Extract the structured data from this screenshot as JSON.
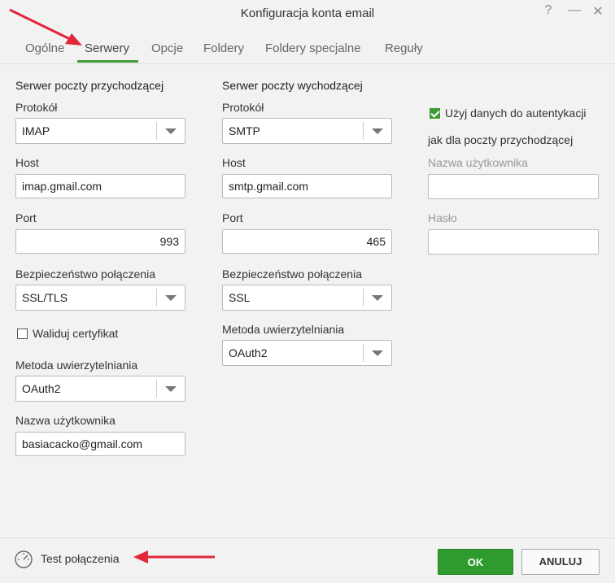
{
  "window": {
    "title": "Konfiguracja konta email",
    "help": "?",
    "minimize": "—",
    "close": "✕"
  },
  "tabs": [
    {
      "label": "Ogólne"
    },
    {
      "label": "Serwery"
    },
    {
      "label": "Opcje"
    },
    {
      "label": "Foldery"
    },
    {
      "label": "Foldery specjalne"
    },
    {
      "label": "Reguły"
    }
  ],
  "active_tab": "Serwery",
  "incoming": {
    "section_title": "Serwer poczty przychodzącej",
    "protocol_label": "Protokół",
    "protocol_value": "IMAP",
    "host_label": "Host",
    "host_value": "imap.gmail.com",
    "port_label": "Port",
    "port_value": "993",
    "security_label": "Bezpieczeństwo połączenia",
    "security_value": "SSL/TLS",
    "validate_cert_label": "Waliduj certyfikat",
    "validate_cert_checked": false,
    "auth_method_label": "Metoda uwierzytelniania",
    "auth_method_value": "OAuth2",
    "username_label": "Nazwa użytkownika",
    "username_value": "basiacacko@gmail.com"
  },
  "outgoing": {
    "section_title": "Serwer poczty wychodzącej",
    "protocol_label": "Protokół",
    "protocol_value": "SMTP",
    "host_label": "Host",
    "host_value": "smtp.gmail.com",
    "port_label": "Port",
    "port_value": "465",
    "security_label": "Bezpieczeństwo połączenia",
    "security_value": "SSL",
    "auth_method_label": "Metoda uwierzytelniania",
    "auth_method_value": "OAuth2"
  },
  "auth": {
    "use_incoming_label_line1": "Użyj danych do autentykacji",
    "use_incoming_label_line2": "jak dla poczty przychodzącej",
    "use_incoming_checked": true,
    "username_label": "Nazwa użytkownika",
    "username_value": "",
    "password_label": "Hasło",
    "password_value": ""
  },
  "footer": {
    "test_label": "Test połączenia",
    "ok_label": "OK",
    "cancel_label": "ANULUJ"
  },
  "colors": {
    "accent": "#3e9b36",
    "ok_button": "#2f9a2d",
    "annotation_arrow": "#e0283a"
  }
}
